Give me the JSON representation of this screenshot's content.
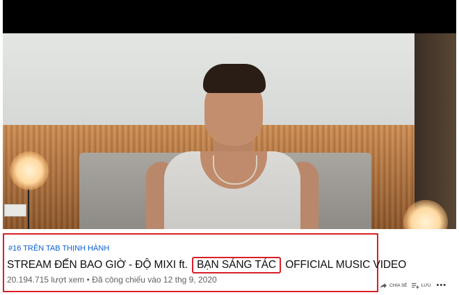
{
  "video": {
    "hashtag": "#16 TRÊN TAB THỊNH HÀNH",
    "title_before": "STREAM ĐẾN BAO GIỜ - ĐỘ MIXI ft.",
    "title_highlight": "BẠN SÁNG TÁC",
    "title_after": "OFFICIAL MUSIC VIDEO",
    "views": "20.194.715 lượt xem",
    "separator": "•",
    "premiere": "Đã công chiếu vào 12 thg 9, 2020"
  },
  "actions": {
    "share_label": "CHIA SẺ",
    "save_label": "LƯU",
    "more_label": "•••"
  },
  "colors": {
    "highlight_border": "#d81f26",
    "hashtag": "#065fd4"
  }
}
